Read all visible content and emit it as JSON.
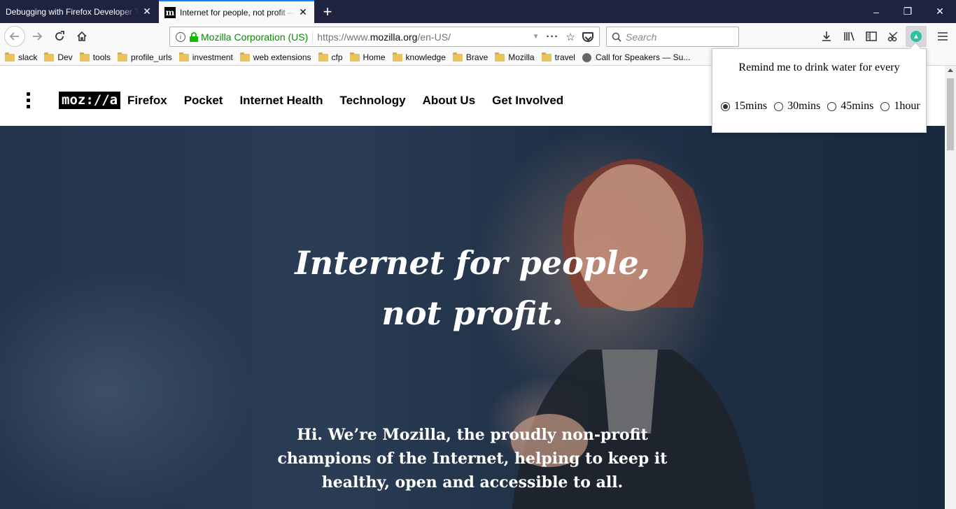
{
  "tabs": [
    {
      "title": "Debugging with Firefox Developer Tools",
      "active": false
    },
    {
      "title": "Internet for people, not profit — Mozilla",
      "active": true,
      "favicon": "m"
    }
  ],
  "toolbar": {
    "url_org": "Mozilla Corporation (US)",
    "url_prefix": "https://www.",
    "url_domain": "mozilla.org",
    "url_path": "/en-US/",
    "search_placeholder": "Search"
  },
  "bookmarks": [
    "slack",
    "Dev",
    "tools",
    "profile_urls",
    "investment",
    "web extensions",
    "cfp",
    "Home",
    "knowledge",
    "Brave",
    "Mozilla",
    "travel",
    "Call for Speakers — Su..."
  ],
  "site": {
    "logo": "moz://a",
    "nav": [
      "Firefox",
      "Pocket",
      "Internet Health",
      "Technology",
      "About Us",
      "Get Involved"
    ],
    "hero_title_line1": "Internet for people,",
    "hero_title_line2": "not profit.",
    "hero_subtitle": "Hi. We’re Mozilla, the proudly non-profit champions of the Internet, helping to keep it healthy, open and accessible to all."
  },
  "popup": {
    "title": "Remind me to drink water for every",
    "options": [
      "15mins",
      "30mins",
      "45mins",
      "1hour"
    ],
    "selected": "15mins"
  },
  "colors": {
    "tabbar": "#202340",
    "secure_green": "#058b00",
    "extension_accent": "#2ac3a2"
  }
}
